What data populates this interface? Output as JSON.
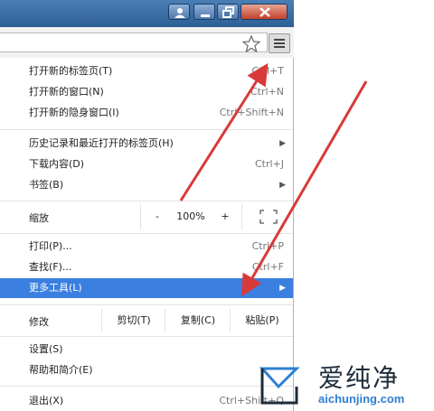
{
  "menu": {
    "items": [
      {
        "label": "打开新的标签页(T)",
        "shortcut": "Ctrl+T"
      },
      {
        "label": "打开新的窗口(N)",
        "shortcut": "Ctrl+N"
      },
      {
        "label": "打开新的隐身窗口(I)",
        "shortcut": "Ctrl+Shift+N"
      },
      {
        "label": "历史记录和最近打开的标签页(H)"
      },
      {
        "label": "下载内容(D)",
        "shortcut": "Ctrl+J"
      },
      {
        "label": "书签(B)"
      },
      {
        "label": "打印(P)...",
        "shortcut": "Ctrl+P"
      },
      {
        "label": "查找(F)...",
        "shortcut": "Ctrl+F"
      },
      {
        "label": "更多工具(L)"
      },
      {
        "label": "设置(S)"
      },
      {
        "label": "帮助和简介(E)"
      },
      {
        "label": "退出(X)",
        "shortcut": "Ctrl+Shift+Q"
      }
    ],
    "zoom": {
      "label": "缩放",
      "minus": "-",
      "value": "100%",
      "plus": "+"
    },
    "edit": {
      "label": "修改",
      "cut": "剪切(T)",
      "copy": "复制(C)",
      "paste": "粘贴(P)"
    }
  },
  "watermark": {
    "brand": "爱纯净",
    "url": "aichunjing.com"
  },
  "colors": {
    "highlight": "#3b7fe0",
    "arrow": "#d83a3a",
    "titlebar": "#3a6ea8"
  }
}
